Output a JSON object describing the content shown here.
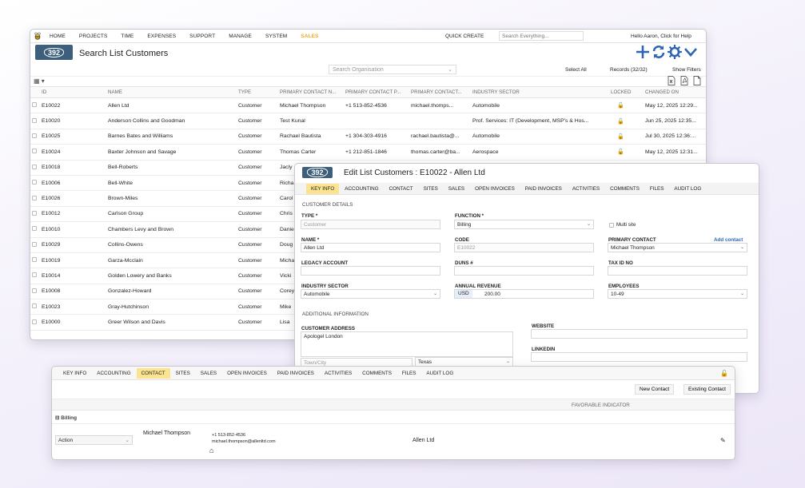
{
  "main": {
    "nav": [
      "HOME",
      "PROJECTS",
      "TIME",
      "EXPENSES",
      "SUPPORT",
      "MANAGE",
      "SYSTEM",
      "SALES"
    ],
    "quick_create": "QUICK CREATE",
    "search_placeholder": "Search Everything...",
    "hello": "Hello Aaron, Click for Help",
    "logo_text": "392",
    "title": "Search List Customers",
    "search_org_placeholder": "Search Organisation",
    "select_all": "Select All",
    "records": "Records (32/32)",
    "show_filters": "Show Filters",
    "columns": [
      "ID",
      "NAME",
      "TYPE",
      "PRIMARY CONTACT N...",
      "PRIMARY CONTACT P...",
      "PRIMARY CONTACT...",
      "INDUSTRY SECTOR",
      "LOCKED",
      "CHANGED ON"
    ],
    "rows": [
      {
        "id": "E10022",
        "name": "Allen Ltd",
        "type": "Customer",
        "contact": "Michael Thompson",
        "phone": "+1 513-852-4536",
        "email": "michael.thomps...",
        "sector": "Automobile",
        "changed": "May 12, 2025 12:29..."
      },
      {
        "id": "E10020",
        "name": "Anderson Collins and Goodman",
        "type": "Customer",
        "contact": "Test Kunal",
        "phone": "",
        "email": "",
        "sector": "Prof. Services: IT (Development, MSP's & Hos...",
        "changed": "Jun 25, 2025 12:35..."
      },
      {
        "id": "E10025",
        "name": "Barnes Bates and Williams",
        "type": "Customer",
        "contact": "Rachael Bautista",
        "phone": "+1 304-303-4916",
        "email": "rachael.bautista@...",
        "sector": "Automobile",
        "changed": "Jul 30, 2025 12:36:..."
      },
      {
        "id": "E10024",
        "name": "Baxter Johnson and Savage",
        "type": "Customer",
        "contact": "Thomas Carter",
        "phone": "+1 212-851-1846",
        "email": "thomas.carter@ba...",
        "sector": "Aerospace",
        "changed": "May 12, 2025 12:31..."
      },
      {
        "id": "E10018",
        "name": "Bell-Roberts",
        "type": "Customer",
        "contact": "Jacly",
        "phone": "",
        "email": "",
        "sector": "",
        "changed": ""
      },
      {
        "id": "E10006",
        "name": "Bell-White",
        "type": "Customer",
        "contact": "Richa",
        "phone": "",
        "email": "",
        "sector": "",
        "changed": ""
      },
      {
        "id": "E10026",
        "name": "Brown-Miles",
        "type": "Customer",
        "contact": "Carol",
        "phone": "",
        "email": "",
        "sector": "",
        "changed": ""
      },
      {
        "id": "E10012",
        "name": "Carlson Group",
        "type": "Customer",
        "contact": "Chris",
        "phone": "",
        "email": "",
        "sector": "",
        "changed": ""
      },
      {
        "id": "E10010",
        "name": "Chambers Levy and Brown",
        "type": "Customer",
        "contact": "Danie",
        "phone": "",
        "email": "",
        "sector": "",
        "changed": ""
      },
      {
        "id": "E10029",
        "name": "Collins-Owens",
        "type": "Customer",
        "contact": "Doug",
        "phone": "",
        "email": "",
        "sector": "",
        "changed": ""
      },
      {
        "id": "E10019",
        "name": "Garza-Mcclain",
        "type": "Customer",
        "contact": "Micha",
        "phone": "",
        "email": "",
        "sector": "",
        "changed": ""
      },
      {
        "id": "E10014",
        "name": "Golden Lowery and Banks",
        "type": "Customer",
        "contact": "Vicki",
        "phone": "",
        "email": "",
        "sector": "",
        "changed": ""
      },
      {
        "id": "E10008",
        "name": "Gonzalez-Howard",
        "type": "Customer",
        "contact": "Corey",
        "phone": "",
        "email": "",
        "sector": "",
        "changed": ""
      },
      {
        "id": "E10023",
        "name": "Gray-Hutchinson",
        "type": "Customer",
        "contact": "Mike",
        "phone": "",
        "email": "",
        "sector": "",
        "changed": ""
      },
      {
        "id": "E10000",
        "name": "Greer Wilson and Davis",
        "type": "Customer",
        "contact": "Lisa",
        "phone": "",
        "email": "",
        "sector": "",
        "changed": ""
      }
    ]
  },
  "edit": {
    "logo_text": "392",
    "title": "Edit List Customers : E10022 - Allen Ltd",
    "tabs": [
      "KEY INFO",
      "ACCOUNTING",
      "CONTACT",
      "SITES",
      "SALES",
      "OPEN INVOICES",
      "PAID INVOICES",
      "ACTIVITIES",
      "COMMENTS",
      "FILES",
      "AUDIT LOG"
    ],
    "customer_details": "CUSTOMER DETAILS",
    "type_label": "TYPE *",
    "type_value": "Customer",
    "function_label": "FUNCTION *",
    "function_value": "Billing",
    "multi_site": "Multi site",
    "name_label": "NAME *",
    "name_value": "Allen Ltd",
    "code_label": "CODE",
    "code_value": "E10022",
    "primary_contact_label": "PRIMARY CONTACT",
    "add_contact": "Add contact",
    "primary_contact_value": "Michael Thompson",
    "legacy_label": "LEGACY ACCOUNT",
    "duns_label": "DUNS #",
    "taxid_label": "TAX ID NO",
    "industry_label": "INDUSTRY SECTOR",
    "industry_value": "Automobile",
    "revenue_label": "ANNUAL REVENUE",
    "revenue_currency": "USD",
    "revenue_value": "200.00",
    "employees_label": "EMPLOYEES",
    "employees_value": "10-49",
    "additional_info": "ADDITIONAL INFORMATION",
    "address_label": "CUSTOMER ADDRESS",
    "address_value": "Apologel London",
    "town_placeholder": "Town/City",
    "state_value": "Texas",
    "website_label": "WEBSITE",
    "linkedin_label": "LINKEDIN"
  },
  "contact": {
    "tabs": [
      "KEY INFO",
      "ACCOUNTING",
      "CONTACT",
      "SITES",
      "SALES",
      "OPEN INVOICES",
      "PAID INVOICES",
      "ACTIVITIES",
      "COMMENTS",
      "FILES",
      "AUDIT LOG"
    ],
    "new_contact": "New Contact",
    "existing_contact": "Existing Contact",
    "favorable_indicator": "FAVORABLE INDICATOR",
    "group": "Billing",
    "action": "Action",
    "contact_name": "Michael Thompson",
    "contact_phone": "+1 513-852-4536",
    "contact_email": "michael.thompson@allenltd.com",
    "company": "Allen Ltd"
  },
  "colors": {
    "accent_orange": "#f5a623",
    "brand_blue": "#2f66b3",
    "logo_bg": "#3e5f7c",
    "active_tab": "#fbe38f"
  }
}
